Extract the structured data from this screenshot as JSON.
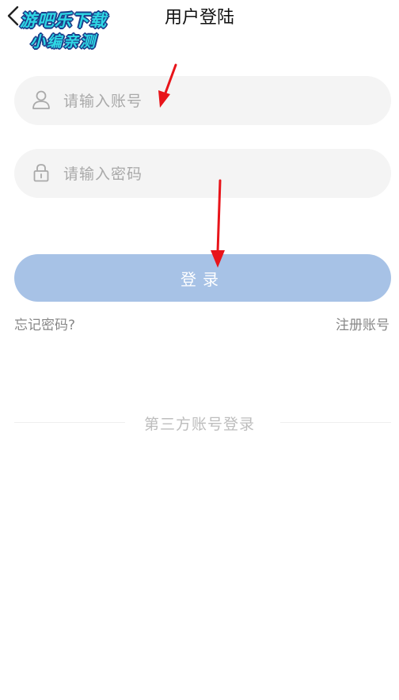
{
  "header": {
    "title": "用户登陆",
    "back_icon": "chevron-left-icon"
  },
  "watermark": {
    "line1": "游吧乐下载",
    "line2": "小编亲测"
  },
  "form": {
    "account": {
      "placeholder": "请输入账号",
      "icon": "user-icon"
    },
    "password": {
      "placeholder": "请输入密码",
      "icon": "lock-icon"
    },
    "login_label": "登录"
  },
  "links": {
    "forgot": "忘记密码?",
    "register": "注册账号"
  },
  "third_party": {
    "label": "第三方账号登录"
  },
  "colors": {
    "login_button": "#a7c2e6",
    "field_background": "#f4f4f4",
    "annotation_arrow": "#e8141a"
  }
}
